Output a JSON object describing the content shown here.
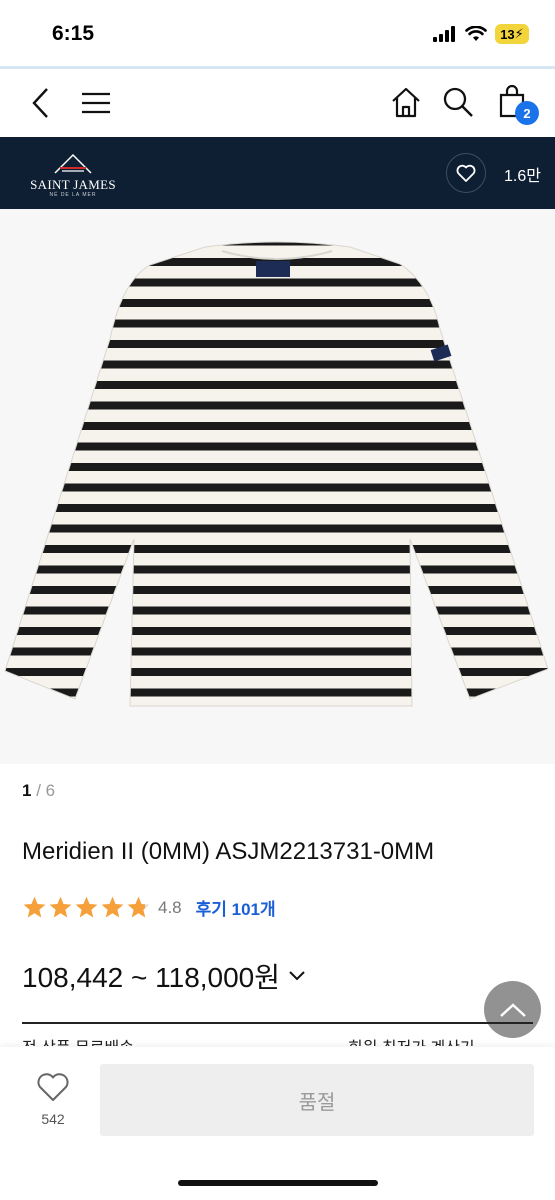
{
  "status_bar": {
    "time": "6:15",
    "battery": "13"
  },
  "header": {
    "back_icon": "chevron-left-icon",
    "menu_icon": "hamburger-icon",
    "home_icon": "home-icon",
    "search_icon": "search-icon",
    "cart_icon": "shopping-bag-icon",
    "cart_count": "2"
  },
  "brand": {
    "name": "SAINT JAMES",
    "subtitle": "NÉ DE LA MER",
    "like_count": "1.6만",
    "background": "#0f1f33"
  },
  "gallery": {
    "current": "1",
    "separator": " / ",
    "total": "6"
  },
  "product": {
    "title": "Meridien II (0MM) ASJM2213731-0MM",
    "rating": "4.8",
    "stars": 4.8,
    "review_link": "후기 101개",
    "price": "108,442 ~ 118,000원"
  },
  "shipping": {
    "left": "전 상품 무료배송",
    "right": "회원 최저가 계산기"
  },
  "bottom_bar": {
    "wish_count": "542",
    "soldout_label": "품절"
  },
  "colors": {
    "accent": "#1a73e8",
    "star": "#f5a03a",
    "review_link": "#1a5fd8"
  }
}
